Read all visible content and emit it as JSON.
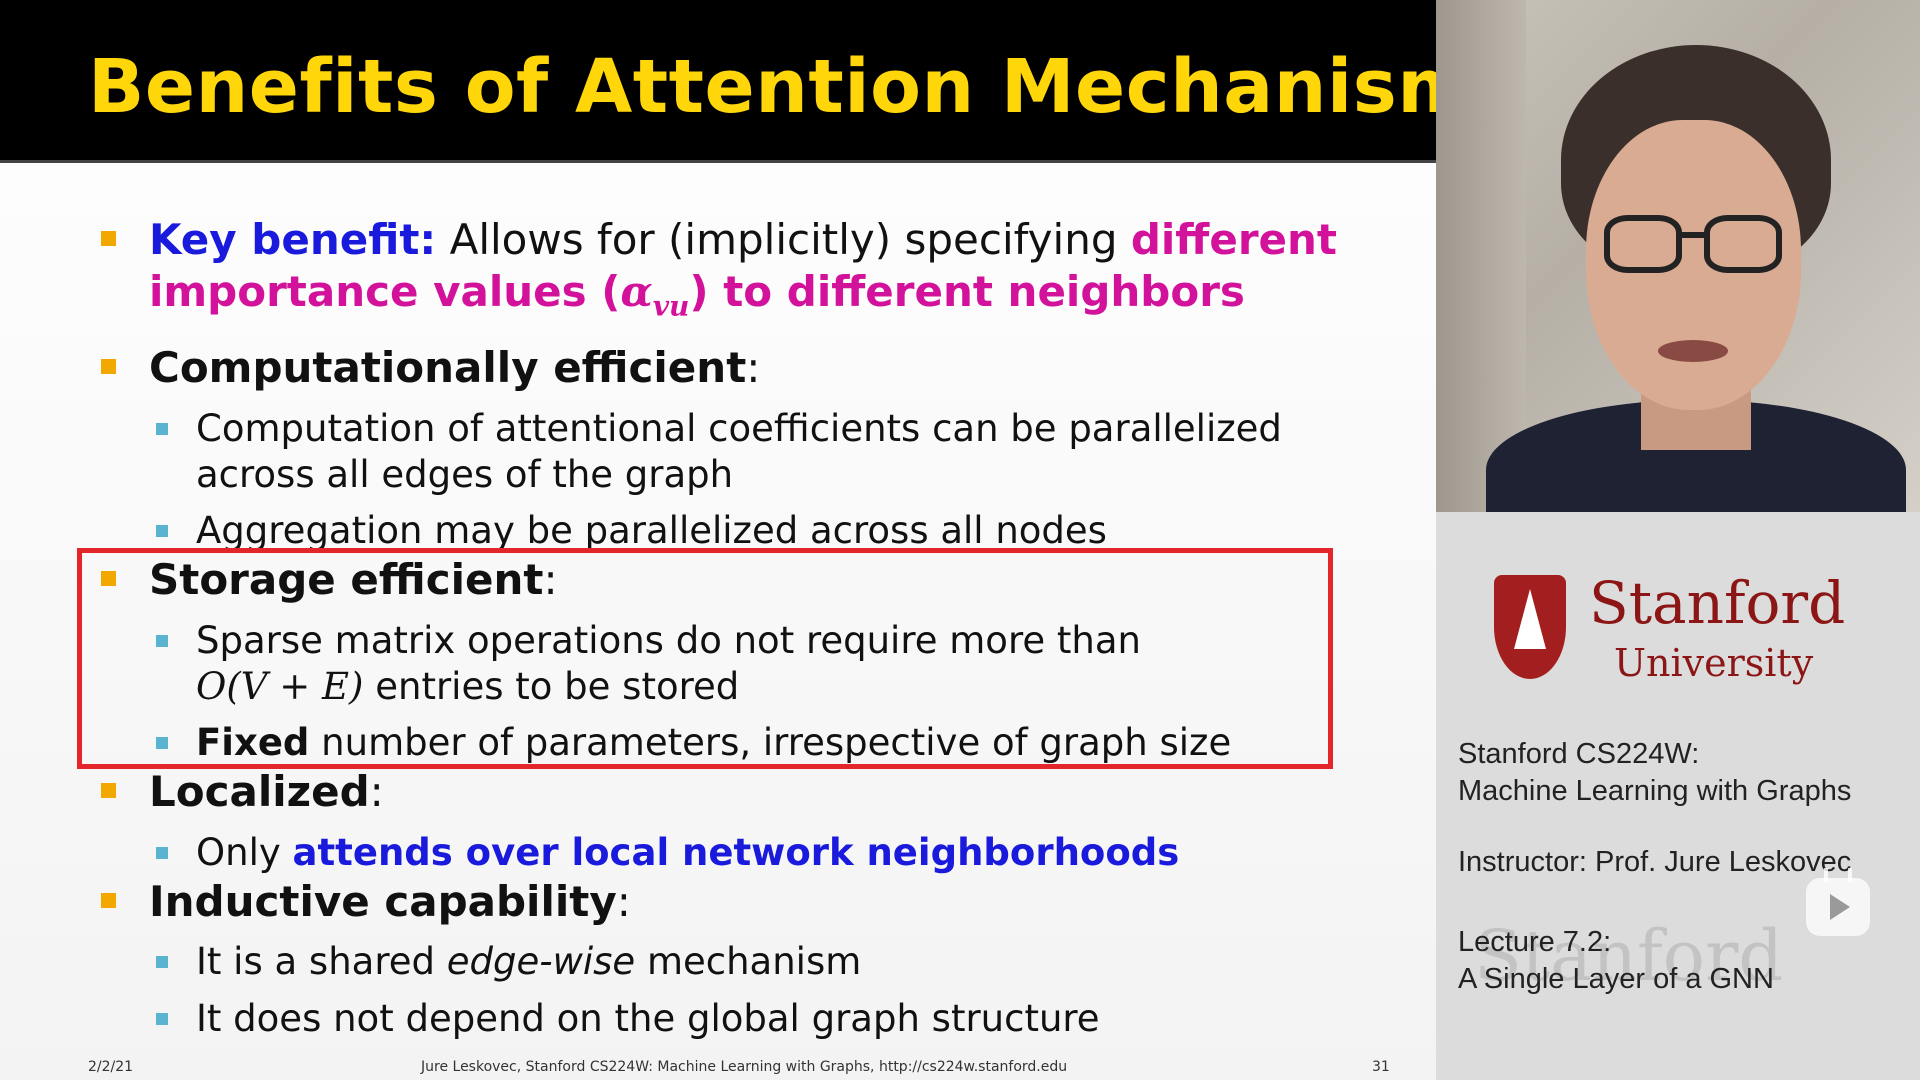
{
  "slide": {
    "title": "Benefits of Attention Mechanism",
    "bullet_key": {
      "label": "Key benefit:",
      "text": " Allows for (implicitly) specifying ",
      "emph1": "different",
      "emph2": "importance values (",
      "alpha": "α",
      "alpha_sub": "vu",
      "emph3": ") to different neighbors"
    },
    "bullet_compute": {
      "label": "Computationally efficient",
      "colon": ":",
      "sub1_line1": "Computation of attentional coefficients can be parallelized",
      "sub1_line2": "across all edges of the graph",
      "sub2": "Aggregation may be parallelized across all nodes"
    },
    "bullet_storage": {
      "label": "Storage efficient",
      "colon": ":",
      "sub1_line1": "Sparse matrix operations do not require more than",
      "sub1_math": "O(V + E)",
      "sub1_line2": " entries to be stored",
      "sub2_bold": "Fixed",
      "sub2_rest": " number of parameters, irrespective of graph size"
    },
    "bullet_localized": {
      "label": "Localized",
      "colon": ":",
      "sub1_pre": "Only ",
      "sub1_emph": "attends over local network neighborhoods"
    },
    "bullet_inductive": {
      "label": "Inductive capability",
      "colon": ":",
      "sub1_pre": "It is a shared ",
      "sub1_ital": "edge-wise",
      "sub1_post": " mechanism",
      "sub2": "It does not depend on the global graph structure"
    },
    "footer": {
      "date": "2/2/21",
      "credit": "Jure Leskovec, Stanford CS224W: Machine Learning with Graphs, http://cs224w.stanford.edu",
      "page": "31"
    }
  },
  "panel": {
    "logo_word1": "Stanford",
    "logo_word2": "University",
    "course_line1": "Stanford CS224W:",
    "course_line2": "Machine Learning with Graphs",
    "instructor": "Instructor: Prof. Jure Leskovec",
    "lecture_line1": "Lecture 7.2:",
    "lecture_line2": "A Single Layer of a GNN",
    "watermark": "Stanford"
  },
  "colors": {
    "title": "#ffd60a",
    "blue_emph": "#1a1adc",
    "magenta_emph": "#d3129b",
    "highlight_border": "#e5252c",
    "bullet_marker": "#f2a800",
    "sub_marker": "#5ab3cf",
    "stanford_red": "#8c1515"
  },
  "icons": {
    "play": "play-icon"
  }
}
